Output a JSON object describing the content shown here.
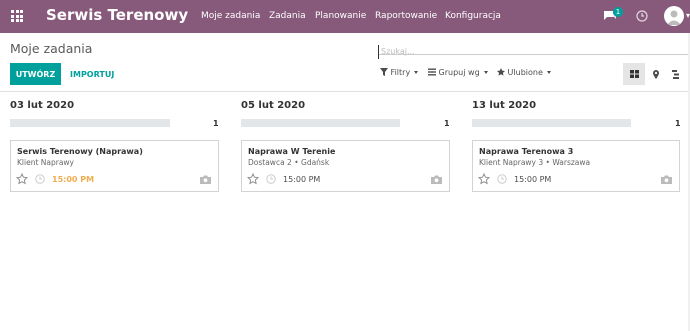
{
  "navbar": {
    "brand": "Serwis Terenowy",
    "menu": [
      {
        "label": "Moje zadania"
      },
      {
        "label": "Zadania"
      },
      {
        "label": "Planowanie"
      },
      {
        "label": "Raportowanie"
      },
      {
        "label": "Konfiguracja"
      }
    ],
    "chat_badge": "1",
    "icons": {
      "apps": "apps-grid-icon",
      "chat": "chat-icon",
      "activity": "clock-icon",
      "user": "avatar"
    },
    "accent": "#875a7b"
  },
  "control_panel": {
    "breadcrumb": "Moje zadania",
    "search_placeholder": "Szukaj...",
    "create_label": "UTWÓRZ",
    "import_label": "IMPORTUJ",
    "filters_label": "Filtry",
    "group_label": "Grupuj wg",
    "favorites_label": "Ulubione",
    "views": [
      "kanban-icon",
      "map-marker-icon",
      "gantt-icon"
    ],
    "primary_color": "#00a09d"
  },
  "kanban": {
    "columns": [
      {
        "title": "03 lut 2020",
        "count": "1",
        "cards": [
          {
            "title": "Serwis Terenowy (Naprawa)",
            "subtitle": "Klient Naprawy",
            "time": "15:00 PM",
            "overdue": true
          }
        ]
      },
      {
        "title": "05 lut 2020",
        "count": "1",
        "cards": [
          {
            "title": "Naprawa W Terenie",
            "subtitle": "Dostawca 2 • Gdańsk",
            "time": "15:00 PM",
            "overdue": false
          }
        ]
      },
      {
        "title": "13 lut 2020",
        "count": "1",
        "cards": [
          {
            "title": "Naprawa Terenowa 3",
            "subtitle": "Klient Naprawy 3 • Warszawa",
            "time": "15:00 PM",
            "overdue": false
          }
        ]
      }
    ],
    "overdue_color": "#f0ad4e"
  }
}
